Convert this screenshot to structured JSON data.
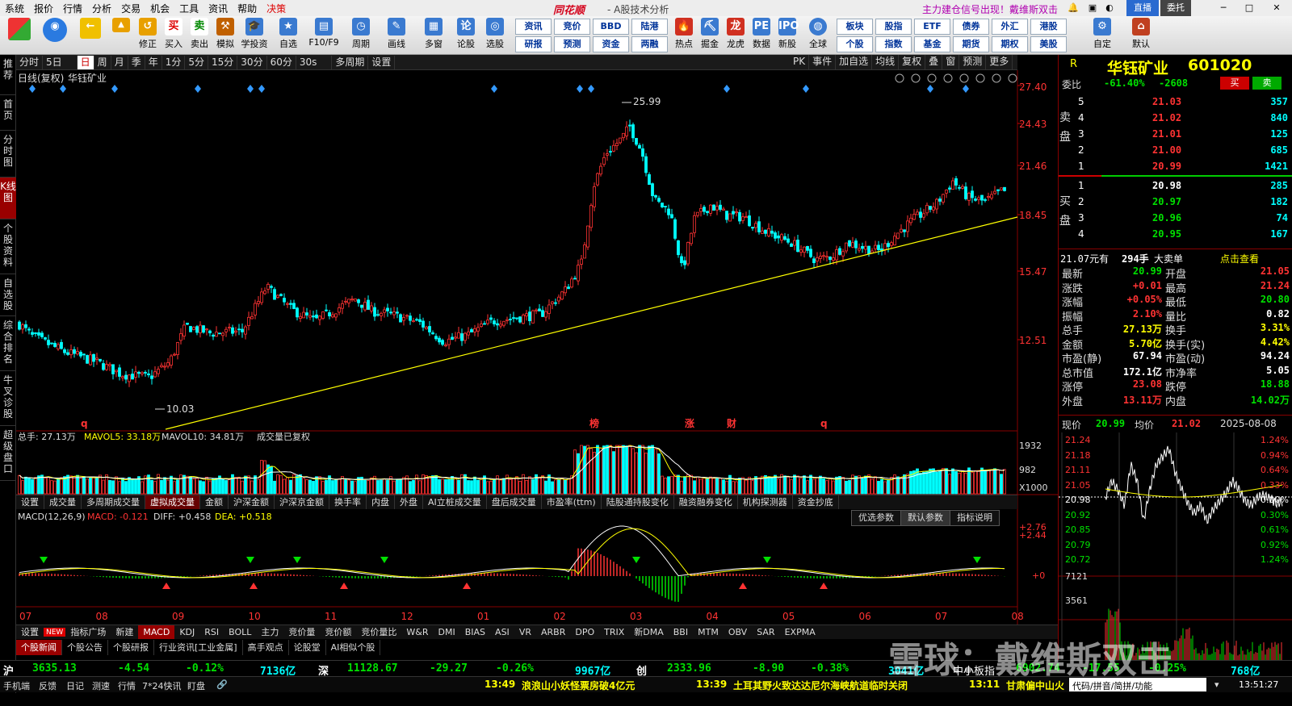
{
  "menu": {
    "items": [
      "系统",
      "报价",
      "行情",
      "分析",
      "交易",
      "机会",
      "工具",
      "资讯",
      "帮助",
      "决策"
    ],
    "brand": "同花顺",
    "subtitle": "- A股技术分析",
    "promo": "主力建仓信号出现！",
    "promo2": "戴维斯双击",
    "mode_btn": "直播",
    "account_btn": "委托"
  },
  "toolbar": {
    "buttons": [
      "修正",
      "买入",
      "卖出",
      "模拟",
      "学投资",
      "自选",
      "F10/F9",
      "周期",
      "画线",
      "多窗",
      "论股",
      "选股",
      "热点",
      "掘金",
      "龙虎",
      "数据",
      "新股",
      "全球",
      "自定",
      "默认"
    ],
    "quick": [
      [
        "资讯",
        "竞价",
        "BBD",
        "陆港"
      ],
      [
        "研报",
        "预测",
        "资金",
        "两融"
      ],
      [
        "板块",
        "股指",
        "ETF",
        "债券",
        "外汇",
        "港股"
      ],
      [
        "个股",
        "指数",
        "基金",
        "期货",
        "期权",
        "美股"
      ]
    ]
  },
  "leftnav": [
    "推荐",
    "首页",
    "分时图",
    "K线图",
    "个股资料",
    "自选股",
    "综合排名",
    "牛叉诊股",
    "超级盘口"
  ],
  "periodbar": {
    "items": [
      "分时",
      "5日",
      "日",
      "周",
      "月",
      "季",
      "年",
      "1分",
      "5分",
      "15分",
      "30分",
      "60分",
      "30s",
      "多周期",
      "设置"
    ],
    "active": "日",
    "right": [
      "PK",
      "事件",
      "加自选",
      "均线",
      "复权",
      "叠",
      "窗",
      "预测",
      "更多"
    ]
  },
  "kline": {
    "title": "日线(复权)",
    "stock_name": "华钰矿业",
    "price_axis": [
      "27.40",
      "24.43",
      "21.46",
      "18.45",
      "15.47",
      "12.51"
    ],
    "high_label": "25.99",
    "low_label": "10.03",
    "markers": [
      "q",
      "榜",
      "涨",
      "财",
      "q"
    ]
  },
  "volume": {
    "header": [
      "总手: 27.13万",
      "MAVOL5: 33.18万",
      "MAVOL10: 34.81万",
      "成交量已复权"
    ],
    "axis": [
      "1932",
      "982",
      "X1000"
    ]
  },
  "indicator_tabs": [
    "设置",
    "成交量",
    "多周期成交量",
    "虚拟成交量",
    "金额",
    "沪深金额",
    "沪深京金额",
    "换手率",
    "内盘",
    "外盘",
    "AI立桩成交量",
    "盘后成交量",
    "市盈率(ttm)",
    "陆股通持股变化",
    "融资融券变化",
    "机构探测器",
    "资金抄底"
  ],
  "macd": {
    "header": [
      "MACD(12,26,9)",
      "MACD: -0.121",
      "DIFF: +0.458",
      "DEA: +0.518"
    ],
    "axis": [
      "+2.76",
      "+2.44",
      "+0"
    ],
    "param_tabs": [
      "优选参数",
      "默认参数",
      "指标说明"
    ]
  },
  "months": [
    "07",
    "08",
    "09",
    "10",
    "11",
    "12",
    "01",
    "02",
    "03",
    "04",
    "05",
    "06",
    "07",
    "08"
  ],
  "bottom_tabs": [
    "设置",
    "NEW",
    "指标广场",
    "新建",
    "MACD",
    "KDJ",
    "RSI",
    "BOLL",
    "主力",
    "竞价量",
    "竞价额",
    "竞价量比",
    "W&R",
    "DMI",
    "BIAS",
    "ASI",
    "VR",
    "ARBR",
    "DPO",
    "TRIX",
    "新DMA",
    "BBI",
    "MTM",
    "OBV",
    "SAR",
    "EXPMA"
  ],
  "news_tabs": [
    "个股新闻",
    "个股公告",
    "个股研报",
    "行业资讯[工业金属]",
    "高手观点",
    "论股堂",
    "AI相似个股"
  ],
  "index_bar": {
    "sh": {
      "name": "沪",
      "value": "3635.13",
      "chg": "-4.54",
      "pct": "-0.12%",
      "amt": "7136亿"
    },
    "sz": {
      "name": "深",
      "value": "11128.67",
      "chg": "-29.27",
      "pct": "-0.26%",
      "amt": "9967亿"
    },
    "cy": {
      "name": "创",
      "value": "2333.96",
      "chg": "-8.90",
      "pct": "-0.38%",
      "amt": "3041亿"
    },
    "zxb": {
      "name": "中小板指",
      "value": "6902.74",
      "chg": "-17.55",
      "pct": "-0.25%",
      "amt": "768亿"
    }
  },
  "statusbar": {
    "items": [
      "手机端",
      "反馈",
      "日记",
      "测速",
      "行情",
      "7*24快讯",
      "盯盘"
    ],
    "news": [
      {
        "time": "13:49",
        "text": "浪浪山小妖怪票房破4亿元"
      },
      {
        "time": "13:39",
        "text": "土耳其野火致达达尼尔海峡航道临时关闭"
      },
      {
        "time": "13:11",
        "text": "甘肃偏中山火"
      }
    ],
    "search": "代码/拼音/简拼/功能",
    "clock": "13:51:27"
  },
  "quote": {
    "r": "R",
    "name": "华钰矿业",
    "code": "601020",
    "weibi_label": "委比",
    "weibi": "-61.40%",
    "weicha": "-2608",
    "buy_btn": "买",
    "sell_btn": "卖",
    "asks": [
      {
        "lv": "5",
        "p": "21.03",
        "v": "357"
      },
      {
        "lv": "4",
        "p": "21.02",
        "v": "840"
      },
      {
        "lv": "3",
        "p": "21.01",
        "v": "125"
      },
      {
        "lv": "2",
        "p": "21.00",
        "v": "685"
      },
      {
        "lv": "1",
        "p": "20.99",
        "v": "1421"
      }
    ],
    "bids": [
      {
        "lv": "1",
        "p": "20.98",
        "v": "285"
      },
      {
        "lv": "2",
        "p": "20.97",
        "v": "182"
      },
      {
        "lv": "3",
        "p": "20.96",
        "v": "74"
      },
      {
        "lv": "4",
        "p": "20.95",
        "v": "167"
      }
    ],
    "sell_label": "卖盘",
    "buy_label": "买盘",
    "big_order": [
      "21.07元有",
      "294手",
      "大卖单",
      "点击查看"
    ],
    "stats": [
      [
        "最新",
        "20.99",
        "开盘",
        "21.05"
      ],
      [
        "涨跌",
        "+0.01",
        "最高",
        "21.24"
      ],
      [
        "涨幅",
        "+0.05%",
        "最低",
        "20.80"
      ],
      [
        "振幅",
        "2.10%",
        "量比",
        "0.82"
      ],
      [
        "总手",
        "27.13万",
        "换手",
        "3.31%"
      ],
      [
        "金额",
        "5.70亿",
        "换手(实)",
        "4.42%"
      ],
      [
        "市盈(静)",
        "67.94",
        "市盈(动)",
        "94.24"
      ],
      [
        "总市值",
        "172.1亿",
        "市净率",
        "5.05"
      ],
      [
        "涨停",
        "23.08",
        "跌停",
        "18.88"
      ],
      [
        "外盘",
        "13.11万",
        "内盘",
        "14.02万"
      ]
    ]
  },
  "intraday": {
    "label_now": "现价",
    "now": "20.99",
    "label_avg": "均价",
    "avg": "21.02",
    "date": "2025-08-08",
    "price_axis": [
      "21.24",
      "21.18",
      "21.11",
      "21.05",
      "20.98",
      "20.92",
      "20.85",
      "20.79",
      "20.72"
    ],
    "pct_axis": [
      "1.24%",
      "0.94%",
      "0.64%",
      "0.33%",
      "0.00%",
      "0.30%",
      "0.61%",
      "0.92%",
      "1.24%"
    ],
    "vol_axis": [
      "7121",
      "3561"
    ]
  },
  "watermark": "雪球：戴维斯双击",
  "colors": {
    "up": "#ff3333",
    "down": "#00ffff",
    "ma": "#ffff00",
    "bg": "#000000"
  }
}
